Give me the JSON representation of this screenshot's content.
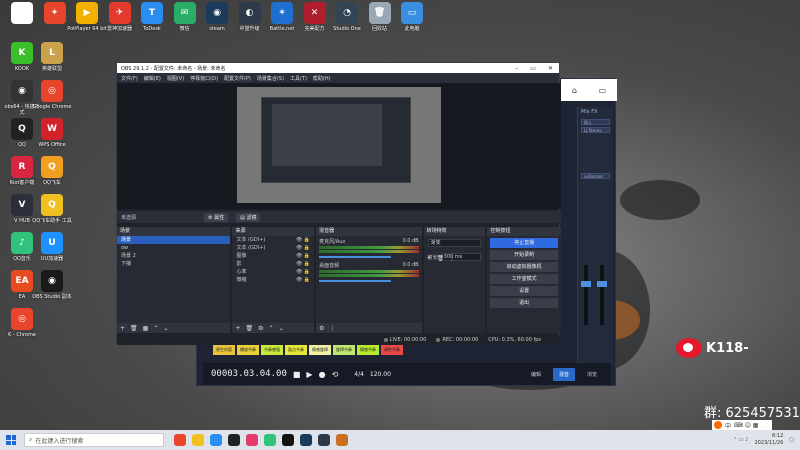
{
  "desktop_icons": [
    {
      "label": "",
      "color": "#ffffff",
      "glyph": "▯"
    },
    {
      "label": "",
      "color": "#e8452c",
      "glyph": "✦"
    },
    {
      "label": "PotPlayer 64 bit",
      "color": "#f2b100",
      "glyph": "▶"
    },
    {
      "label": "雷神加速器",
      "color": "#e23b2e",
      "glyph": "✈"
    },
    {
      "label": "ToDesk",
      "color": "#2a8ef0",
      "glyph": "T"
    },
    {
      "label": "微信",
      "color": "#2aae67",
      "glyph": "✉"
    },
    {
      "label": "steam",
      "color": "#1b3a5c",
      "glyph": "◉"
    },
    {
      "label": "中望升级",
      "color": "#2d3a4a",
      "glyph": "◐"
    },
    {
      "label": "Battle.net",
      "color": "#1f6fd0",
      "glyph": "✶"
    },
    {
      "label": "完美配方",
      "color": "#b01e2e",
      "glyph": "✕"
    },
    {
      "label": "Studio One",
      "color": "#334455",
      "glyph": "◔"
    },
    {
      "label": "回收站",
      "color": "#9aa8b6",
      "glyph": "🗑"
    },
    {
      "label": "此电脑",
      "color": "#3b8fe0",
      "glyph": "▭"
    },
    {
      "label": "KOOK",
      "color": "#3bbf2a",
      "glyph": "K"
    },
    {
      "label": "英雄联盟",
      "color": "#c9a24b",
      "glyph": "L"
    },
    {
      "label": "obs64 - 快捷方式",
      "color": "#333333",
      "glyph": "◉"
    },
    {
      "label": "Google Chrome",
      "color": "#e8452c",
      "glyph": "◎"
    },
    {
      "label": "QQ",
      "color": "#222222",
      "glyph": "Q"
    },
    {
      "label": "WPS Office",
      "color": "#d2232a",
      "glyph": "W"
    },
    {
      "label": "Riot客户端",
      "color": "#d9253e",
      "glyph": "R"
    },
    {
      "label": "QQ飞车",
      "color": "#f0a020",
      "glyph": "Q"
    },
    {
      "label": "V HUB",
      "color": "#2a2f3a",
      "glyph": "V"
    },
    {
      "label": "QQ飞车助手 工具",
      "color": "#f0c020",
      "glyph": "Q"
    },
    {
      "label": "QQ音乐",
      "color": "#31c27c",
      "glyph": "♪"
    },
    {
      "label": "UU加速器",
      "color": "#1e90ff",
      "glyph": "U"
    },
    {
      "label": "EA",
      "color": "#e84b20",
      "glyph": "EA"
    },
    {
      "label": "OBS Studio 副本",
      "color": "#1a1a1a",
      "glyph": "◉"
    },
    {
      "label": "K - Chrome",
      "color": "#e8452c",
      "glyph": "◎"
    }
  ],
  "obs": {
    "title": "OBS 29.1.2 - 配置文件: 未命名 - 场景: 未命名",
    "menu": [
      "文件(F)",
      "编辑(E)",
      "视图(V)",
      "停靠窗口(D)",
      "配置文件(P)",
      "场景集合(S)",
      "工具(T)",
      "帮助(H)"
    ],
    "status_left": "未选源",
    "properties_btn": "属性",
    "filters_btn": "滤镜",
    "scenes": {
      "title": "场景",
      "items": [
        "场景",
        "ow",
        "场景 2",
        "下播"
      ],
      "selected": 0
    },
    "sources": {
      "title": "来源",
      "items": [
        "文本 (GDI+)",
        "文本 (GDI+)",
        "图像",
        "影",
        "心率",
        "微缩"
      ]
    },
    "mixer": {
      "title": "混音器",
      "channels": [
        {
          "name": "麦克风/Aux",
          "db": "0.0 dB"
        },
        {
          "name": "桌面音频",
          "db": "0.0 dB"
        }
      ]
    },
    "transitions": {
      "title": "转场特效",
      "type": "渐变",
      "duration_label": "时长",
      "duration": "300 ms"
    },
    "controls": {
      "title": "控制按钮",
      "buttons": [
        "停止直播",
        "开始录制",
        "启动虚拟摄像机",
        "工作室模式",
        "设置",
        "退出"
      ]
    },
    "statusbar": {
      "live": "LIVE: 00:00:00",
      "rec": "REC: 00:00:00",
      "cpu": "CPU: 0.3%, 60.00 fps"
    }
  },
  "bgapp": {
    "panel_title": "Mix FX",
    "chips": [
      "插入",
      "LJ Stereo"
    ],
    "chip2": "vsDender",
    "colorbar": [
      {
        "label": "原生内容",
        "color": "#e8c23a"
      },
      {
        "label": "播放节奏",
        "color": "#e8d03a"
      },
      {
        "label": "节奏感强",
        "color": "#c9e83a"
      },
      {
        "label": "鼓点节奏",
        "color": "#e8e83a"
      },
      {
        "label": "情感旋律",
        "color": "#f0f0a0"
      },
      {
        "label": "旋律节奏",
        "color": "#c0e870"
      },
      {
        "label": "情感节奏",
        "color": "#b9e830"
      },
      {
        "label": "调性节奏",
        "color": "#e84848"
      }
    ],
    "timecode": "00003.03.04.00",
    "tempo": "120.00",
    "signature": "4/4",
    "tabs": [
      "编辑",
      "混音",
      "浏览"
    ],
    "active_tab": 1
  },
  "watermark": {
    "weibo": "K118-",
    "group": "群: 625457531"
  },
  "taskbar": {
    "search_placeholder": "在此键入进行搜索",
    "time": "8:12",
    "date": "2023/11/26",
    "ime": "中"
  }
}
